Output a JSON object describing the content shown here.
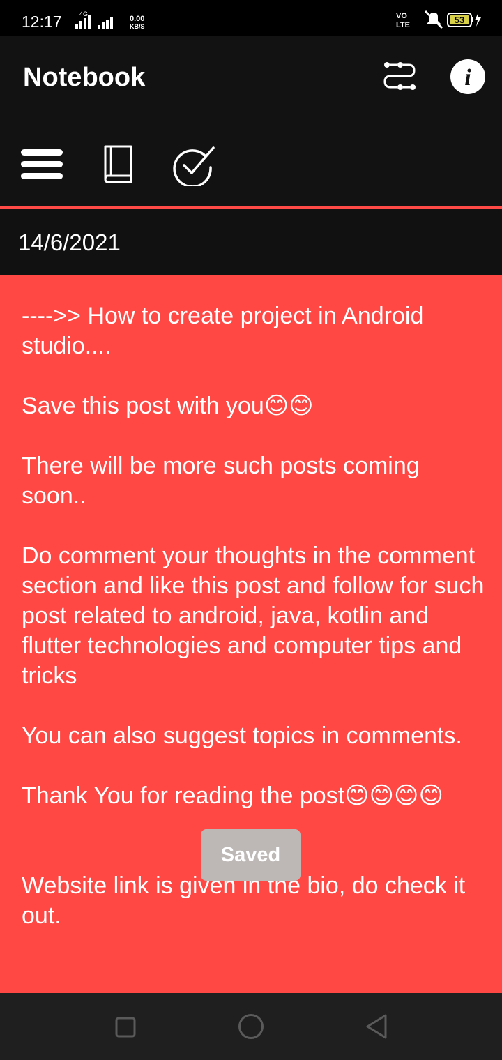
{
  "status_bar": {
    "time": "12:17",
    "network_speed_value": "0.00",
    "network_speed_unit": "KB/S",
    "signal_label": "4G",
    "volte_label_top": "VO",
    "volte_label_bottom": "LTE",
    "battery_level": "53"
  },
  "app_bar": {
    "title": "Notebook",
    "icons": [
      "sort-icon",
      "info-icon",
      "menu-icon",
      "notebook-icon",
      "checkmark-icon"
    ]
  },
  "accent_color": "#ff4a45",
  "note": {
    "date": "14/6/2021",
    "background_color": "#ff4844",
    "body": "---->> How to create project in Android studio....\n\nSave this post with you😊😊\n\nThere will be more such posts coming soon..\n\nDo comment your thoughts in the comment section and like this post and follow for such post related to android, java, kotlin and flutter technologies and computer tips and tricks\n\nYou can also suggest topics in comments.\n\nThank You for reading the post😊😊😊😊\n\n\nWebsite link is given in the bio, do check it out."
  },
  "toast": {
    "text": "Saved"
  },
  "nav_bar": {
    "buttons": [
      "recents-button",
      "home-button",
      "back-button"
    ]
  }
}
